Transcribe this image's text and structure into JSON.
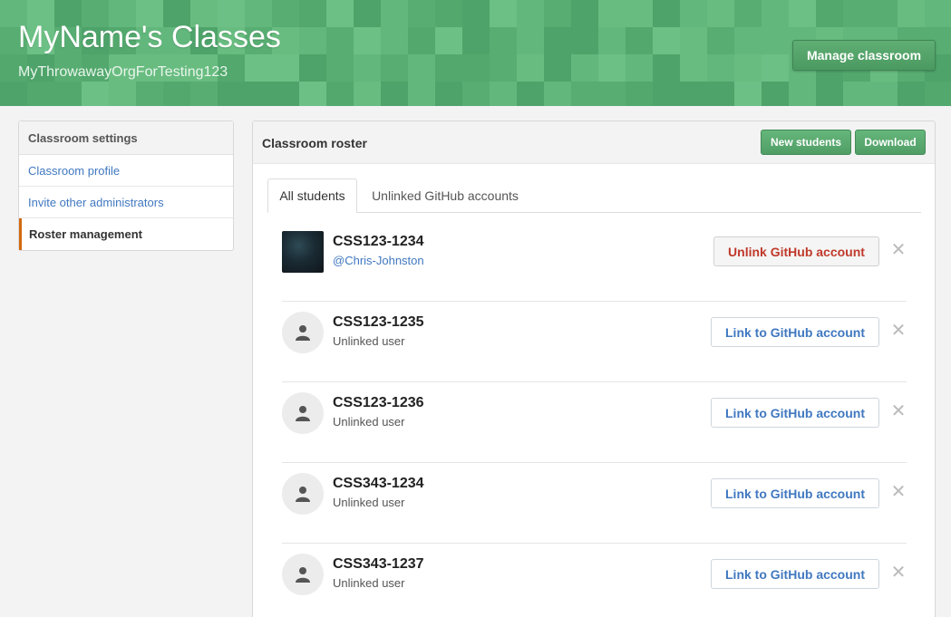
{
  "header": {
    "title": "MyName's Classes",
    "subtitle": "MyThrowawayOrgForTesting123",
    "manage_label": "Manage classroom"
  },
  "sidebar": {
    "heading": "Classroom settings",
    "items": [
      {
        "label": "Classroom profile",
        "active": false
      },
      {
        "label": "Invite other administrators",
        "active": false
      },
      {
        "label": "Roster management",
        "active": true
      }
    ]
  },
  "panel": {
    "title": "Classroom roster",
    "new_students_label": "New students",
    "download_label": "Download",
    "tabs": [
      {
        "label": "All students",
        "active": true
      },
      {
        "label": "Unlinked GitHub accounts",
        "active": false
      }
    ]
  },
  "students": [
    {
      "id": "CSS123-1234",
      "sub": "@Chris-Johnston",
      "linked": true,
      "action": "Unlink GitHub account",
      "avatar": "photo-avatar"
    },
    {
      "id": "CSS123-1235",
      "sub": "Unlinked user",
      "linked": false,
      "action": "Link to GitHub account",
      "avatar": "person-icon"
    },
    {
      "id": "CSS123-1236",
      "sub": "Unlinked user",
      "linked": false,
      "action": "Link to GitHub account",
      "avatar": "person-icon"
    },
    {
      "id": "CSS343-1234",
      "sub": "Unlinked user",
      "linked": false,
      "action": "Link to GitHub account",
      "avatar": "person-icon"
    },
    {
      "id": "CSS343-1237",
      "sub": "Unlinked user",
      "linked": false,
      "action": "Link to GitHub account",
      "avatar": "person-icon"
    }
  ],
  "colors": {
    "header_green": "#5fb47a",
    "button_green": "#509e66",
    "link_blue": "#4078c0",
    "unlink_red": "#c0392b",
    "active_accent": "#d26911"
  }
}
